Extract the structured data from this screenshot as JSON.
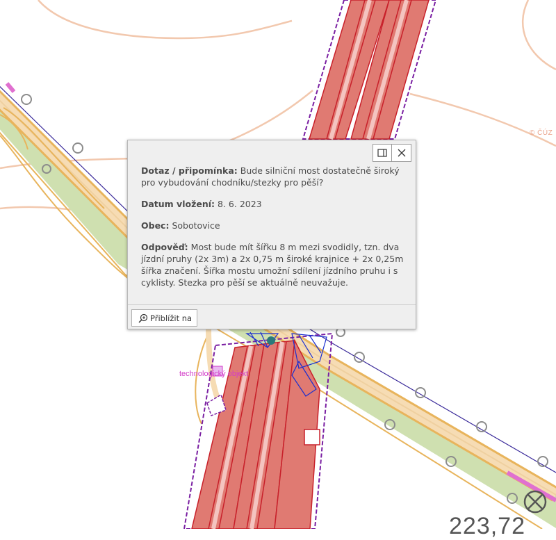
{
  "map": {
    "feature_label": "technologický objekt",
    "watermark": "© ČÚZ",
    "elevation_label": "223,72"
  },
  "popup": {
    "fields": [
      {
        "label": "Dotaz / připomínka:",
        "value": "Bude silniční most dostatečně široký pro vybudování chodníku/stezky pro pěší?"
      },
      {
        "label": "Datum vložení:",
        "value": "8. 6. 2023"
      },
      {
        "label": "Obec:",
        "value": "Sobotovice"
      },
      {
        "label": "Odpověď:",
        "value": "Most bude mít šířku 8 m mezi svodidly, tzn. dva jízdní pruhy (2x 3m) a 2x 0,75 m široké krajnice + 2x 0,25m šířka značení. Šířka mostu umožní sdílení jízdního pruhu i s cyklisty. Stezka pro pěší se aktuálně neuvažuje."
      }
    ],
    "zoom_button_label": "Přiblížit na",
    "icons": {
      "dock": "dock-icon",
      "close": "close-icon",
      "zoom": "zoom-in-icon"
    }
  },
  "colors": {
    "rail_fill": "#e07a72",
    "rail_line": "#c8202a",
    "boundary": "#7a1fa2",
    "road_fill": "#f6dcb4",
    "road_edge": "#e8b45c",
    "contour": "#f2c8ae",
    "green_strip": "#cfe0b0",
    "blue_struct": "#1a2fd0",
    "popup_bg": "#efefef"
  }
}
